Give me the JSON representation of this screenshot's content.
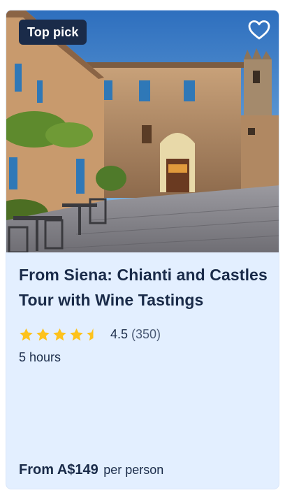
{
  "card": {
    "badge": "Top pick",
    "title": "From Siena: Chianti and Castles Tour with Wine Tastings",
    "rating": {
      "value": "4.5",
      "count": "(350)",
      "stars_filled": 4.5,
      "stars_total": 5
    },
    "duration": "5 hours",
    "price": {
      "main": "From A$149",
      "unit": "per person"
    },
    "icons": {
      "wishlist": "heart-icon",
      "star": "star-icon"
    },
    "colors": {
      "card_bg": "#e3efff",
      "title": "#1a2b49",
      "badge_bg": "#1a2b49",
      "star": "#fdc21c"
    }
  }
}
